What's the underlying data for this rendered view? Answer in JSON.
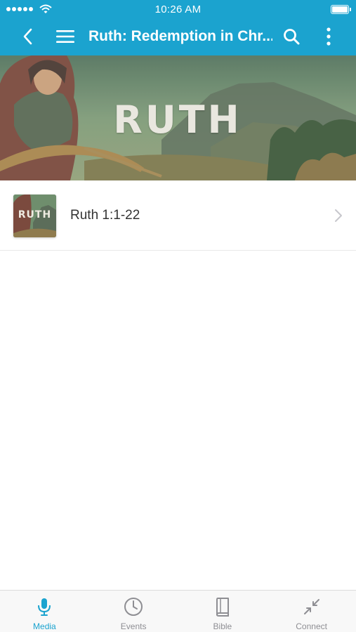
{
  "status_bar": {
    "time": "10:26 AM"
  },
  "nav": {
    "title": "Ruth: Redemption in Chr..."
  },
  "hero": {
    "title": "RUTH"
  },
  "list": {
    "items": [
      {
        "thumbnail_text": "RUTH",
        "title": "Ruth 1:1-22"
      }
    ]
  },
  "tabs": [
    {
      "label": "Media",
      "icon": "microphone-icon",
      "active": true
    },
    {
      "label": "Events",
      "icon": "clock-icon",
      "active": false
    },
    {
      "label": "Bible",
      "icon": "book-icon",
      "active": false
    },
    {
      "label": "Connect",
      "icon": "connect-icon",
      "active": false
    }
  ],
  "colors": {
    "accent": "#1ba3cf",
    "tab_inactive": "#8e8e93",
    "text": "#333333"
  }
}
